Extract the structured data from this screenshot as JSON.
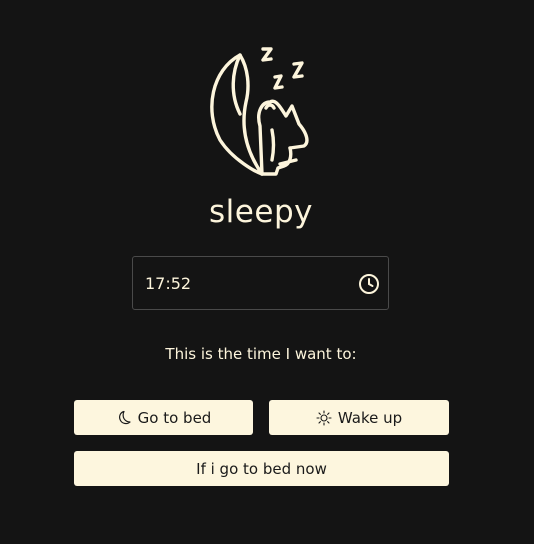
{
  "app": {
    "title": "sleepy",
    "logo_icon": "sleeping-moon-cat-icon"
  },
  "time_input": {
    "value": "17:52",
    "icon": "clock-icon"
  },
  "prompt": "This is the time I want to:",
  "buttons": {
    "go_to_bed": {
      "label": "Go to bed",
      "icon": "moon-icon"
    },
    "wake_up": {
      "label": "Wake up",
      "icon": "sun-icon"
    },
    "bed_now": {
      "label": "If i go to bed now"
    }
  },
  "colors": {
    "background": "#141414",
    "accent": "#fdf5dc",
    "button_text": "#1a1a1a"
  }
}
